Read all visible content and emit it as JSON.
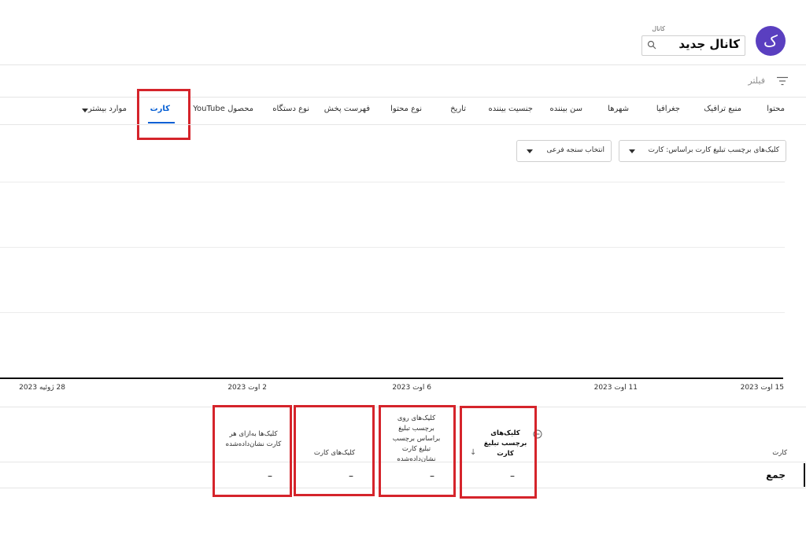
{
  "header": {
    "avatar_letter": "ک",
    "channel_small_label": "کانال",
    "channel_name": "کانال جدید"
  },
  "filter": {
    "label": "فیلتر"
  },
  "tabs": [
    {
      "label": "محتوا"
    },
    {
      "label": "منبع ترافیک"
    },
    {
      "label": "جغرافیا"
    },
    {
      "label": "شهرها"
    },
    {
      "label": "سن بیننده"
    },
    {
      "label": "جنسیت بیننده"
    },
    {
      "label": "تاریخ"
    },
    {
      "label": "نوع محتوا"
    },
    {
      "label": "فهرست پخش"
    },
    {
      "label": "نوع دستگاه"
    },
    {
      "label": "محصول YouTube"
    },
    {
      "label": "کارت",
      "active": true
    },
    {
      "label": "موارد بیشتر"
    }
  ],
  "dropdowns": {
    "primary": "کلیک‌های برچسب تبلیغ کارت براساس: کارت",
    "secondary": "انتخاب سنجه فرعی"
  },
  "chart": {
    "x_ticks": [
      "15 اوت 2023",
      "11 اوت 2023",
      "6 اوت 2023",
      "2 اوت 2023",
      "28 ژوئیه 2023"
    ]
  },
  "table": {
    "first_col_header": "کارت",
    "columns": [
      {
        "header": "کلیک‌های برچسب تبلیغ کارت",
        "value": "–"
      },
      {
        "header": "کلیک‌های روی برچسب تبلیغ براساس برچسب تبلیغ کارت نشان‌داده‌شده",
        "value": "–"
      },
      {
        "header": "کلیک‌های کارت",
        "value": "–"
      },
      {
        "header": "کلیک‌ها به‌ازای هر کارت نشان‌داده‌شده",
        "value": "–"
      }
    ],
    "total_label": "جمع"
  },
  "colors": {
    "accent": "#065fd4",
    "avatar": "#5a3fc0",
    "highlight": "#d5242b"
  }
}
